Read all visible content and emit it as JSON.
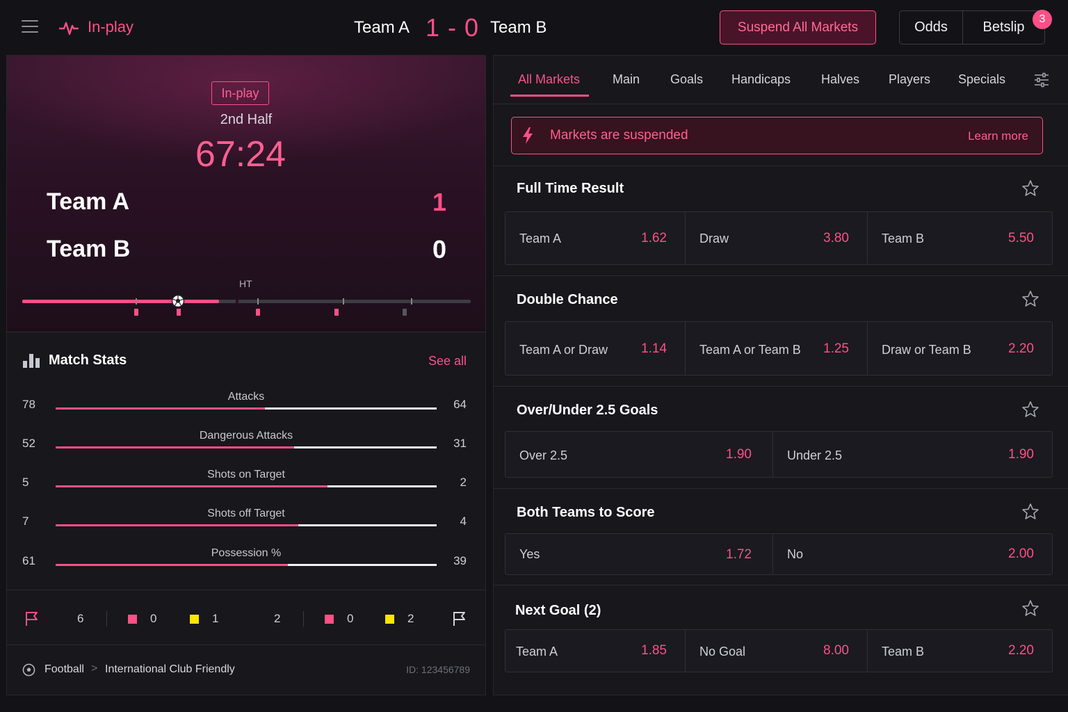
{
  "header": {
    "brand_label": "In-play",
    "team_a": "Team A",
    "team_b": "Team B",
    "score": "1 - 0",
    "suspend_label": "Suspend All Markets",
    "odds_label": "Odds",
    "betslip_label": "Betslip",
    "betslip_count": "3"
  },
  "match": {
    "status_tag": "In-play",
    "period": "2nd Half",
    "clock": "67:24",
    "team_a": "Team A",
    "team_b": "Team B",
    "score_a": "1",
    "score_b": "0",
    "ht_label": "HT",
    "timeline_progress_minutes": 67.4
  },
  "stats": {
    "title": "Match Stats",
    "see_all": "See all",
    "rows": [
      {
        "label": "Attacks",
        "home": "78",
        "away": "64"
      },
      {
        "label": "Dangerous Attacks",
        "home": "52",
        "away": "31"
      },
      {
        "label": "Shots on Target",
        "home": "5",
        "away": "2"
      },
      {
        "label": "Shots off Target",
        "home": "7",
        "away": "4"
      },
      {
        "label": "Possession %",
        "home": "61",
        "away": "39"
      }
    ]
  },
  "cards": {
    "home_corners": "6",
    "home_red": "0",
    "home_yellow": "1",
    "away_corners": "2",
    "away_red": "0",
    "away_yellow": "2"
  },
  "footer": {
    "sport": "Football",
    "competition": "International Club Friendly",
    "separator": ">",
    "match_id": "ID: 123456789"
  },
  "tabs": [
    "All Markets",
    "Main",
    "Goals",
    "Handicaps",
    "Halves",
    "Players",
    "Specials"
  ],
  "alert": {
    "text": "Markets are suspended",
    "link": "Learn more"
  },
  "markets": [
    {
      "title": "Full Time Result",
      "selections": [
        {
          "label": "Team A",
          "price": "1.62"
        },
        {
          "label": "Draw",
          "price": "3.80"
        },
        {
          "label": "Team B",
          "price": "5.50"
        }
      ]
    },
    {
      "title": "Double Chance",
      "selections": [
        {
          "label": "Team A or Draw",
          "price": "1.14"
        },
        {
          "label": "Team A or Team B",
          "price": "1.25"
        },
        {
          "label": "Draw or Team B",
          "price": "2.20"
        }
      ]
    },
    {
      "title": "Over/Under 2.5 Goals",
      "selections": [
        {
          "label": "Over 2.5",
          "price": "1.90"
        },
        {
          "label": "Under 2.5",
          "price": "1.90"
        }
      ]
    },
    {
      "title": "Both Teams to Score",
      "selections": [
        {
          "label": "Yes",
          "price": "1.72"
        },
        {
          "label": "No",
          "price": "2.00"
        }
      ]
    },
    {
      "title": "Next Goal (2)",
      "selections": [
        {
          "label": "Team A",
          "price": "1.85"
        },
        {
          "label": "No Goal",
          "price": "8.00"
        },
        {
          "label": "Team B",
          "price": "2.20"
        }
      ]
    }
  ],
  "colors": {
    "accent": "#ff4f86",
    "background": "#131317",
    "panel": "#17171c",
    "yellow_card": "#ffe600"
  }
}
